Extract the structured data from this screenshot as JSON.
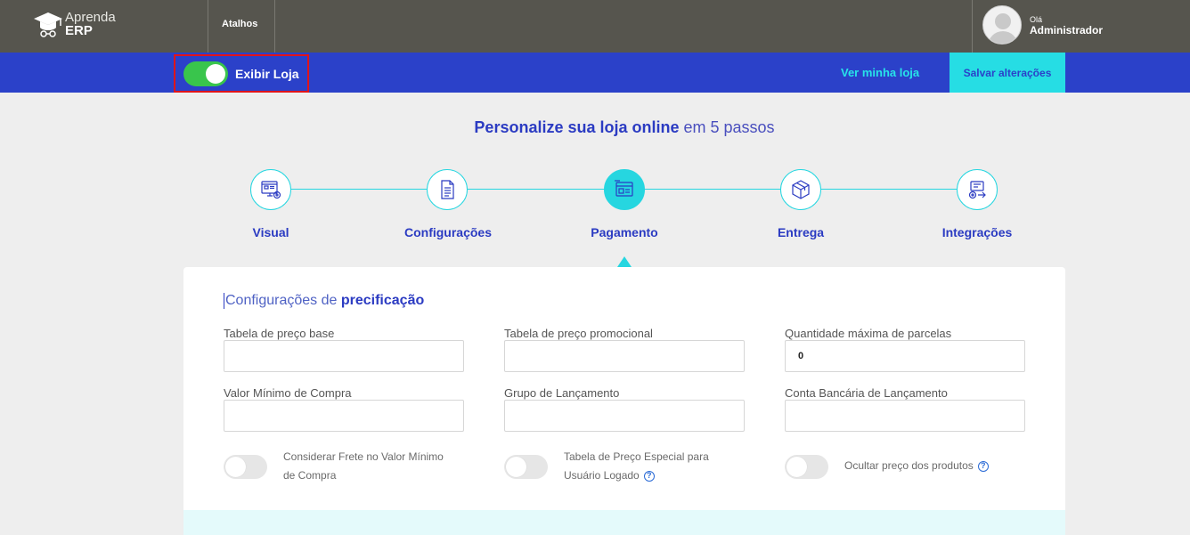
{
  "app": {
    "logo_line1": "Aprenda",
    "logo_line2": "ERP"
  },
  "topbar": {
    "shortcuts_label": "Atalhos",
    "user_greeting": "Olá",
    "user_name": "Administrador"
  },
  "storebar": {
    "show_store_label": "Exibir Loja",
    "show_store_on": true,
    "view_store_label": "Ver minha loja",
    "save_label": "Salvar alterações"
  },
  "heading": {
    "bold": "Personalize sua loja online",
    "rest": " em 5 passos"
  },
  "steps": [
    {
      "label": "Visual",
      "icon": "monitor-settings-icon",
      "active": false
    },
    {
      "label": "Configurações",
      "icon": "document-icon",
      "active": false
    },
    {
      "label": "Pagamento",
      "icon": "payment-icon",
      "active": true
    },
    {
      "label": "Entrega",
      "icon": "package-icon",
      "active": false
    },
    {
      "label": "Integrações",
      "icon": "integration-icon",
      "active": false
    }
  ],
  "pricing": {
    "title_light": "Configurações de ",
    "title_bold": "precificação",
    "fields": [
      {
        "label": "Tabela de preço base",
        "value": ""
      },
      {
        "label": "Tabela de preço promocional",
        "value": ""
      },
      {
        "label": "Quantidade máxima de parcelas",
        "value": "0"
      },
      {
        "label": "Valor Mínimo de Compra",
        "value": ""
      },
      {
        "label": "Grupo de Lançamento",
        "value": ""
      },
      {
        "label": "Conta Bancária de Lançamento",
        "value": ""
      }
    ],
    "toggles": [
      {
        "line1": "Considerar Frete no Valor Mínimo",
        "line2": "de Compra",
        "on": false,
        "help": false
      },
      {
        "line1": "Tabela de Preço Especial para",
        "line2": "Usuário Logado",
        "on": false,
        "help": true
      },
      {
        "line1": "Ocultar preço dos produtos",
        "line2": "",
        "on": false,
        "help": true
      }
    ]
  },
  "colors": {
    "topbar": "#56554e",
    "primary_blue": "#2b41c9",
    "accent_cyan": "#26dde4",
    "toggle_green": "#39c54c"
  }
}
